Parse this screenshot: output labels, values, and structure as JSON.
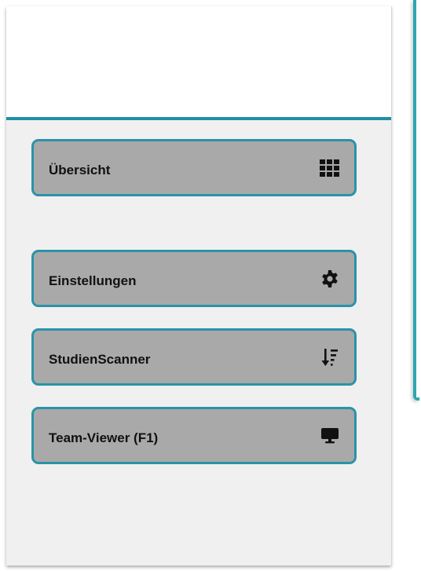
{
  "sidebar": {
    "items": [
      {
        "label": "Übersicht",
        "icon": "grid-icon"
      },
      {
        "label": "Einstellungen",
        "icon": "gear-icon"
      },
      {
        "label": "StudienScanner",
        "icon": "sort-descending-icon"
      },
      {
        "label": "Team-Viewer (F1)",
        "icon": "monitor-icon"
      }
    ]
  },
  "colors": {
    "accent": "#2a93a8",
    "button_background": "#a9a9a9",
    "sidebar_background": "#f0f0f0",
    "header_rule": "#1e90a8"
  }
}
